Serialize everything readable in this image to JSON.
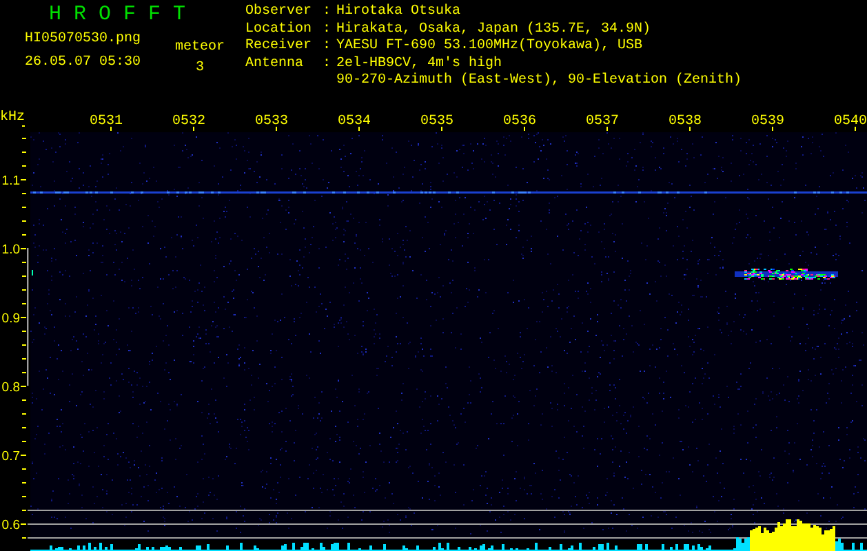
{
  "app_title": "H R O F F T",
  "file_name": "HI05070530.png",
  "timestamp": "26.05.07 05:30",
  "meteor": {
    "label": "meteor",
    "count": "3"
  },
  "station": [
    {
      "label": "Observer",
      "separator": ":",
      "lines": [
        "Hirotaka Otsuka"
      ]
    },
    {
      "label": "Location",
      "separator": ":",
      "lines": [
        "Hirakata, Osaka, Japan (135.7E, 34.9N)"
      ]
    },
    {
      "label": "Receiver",
      "separator": ":",
      "lines": [
        "YAESU FT-690 53.100MHz(Toyokawa), USB"
      ]
    },
    {
      "label": "Antenna",
      "separator": ":",
      "lines": [
        "2el-HB9CV, 4m's high",
        "90-270-Azimuth (East-West), 90-Elevation (Zenith)"
      ]
    }
  ],
  "spectrogram": {
    "y_unit": "kHz",
    "time_labels": [
      "0531",
      "0532",
      "0533",
      "0534",
      "0535",
      "0536",
      "0537",
      "0538",
      "0539",
      "0540"
    ],
    "freq_labels": [
      "1.1",
      "1.0",
      "0.9",
      "0.8",
      "0.7",
      "0.6"
    ]
  }
}
